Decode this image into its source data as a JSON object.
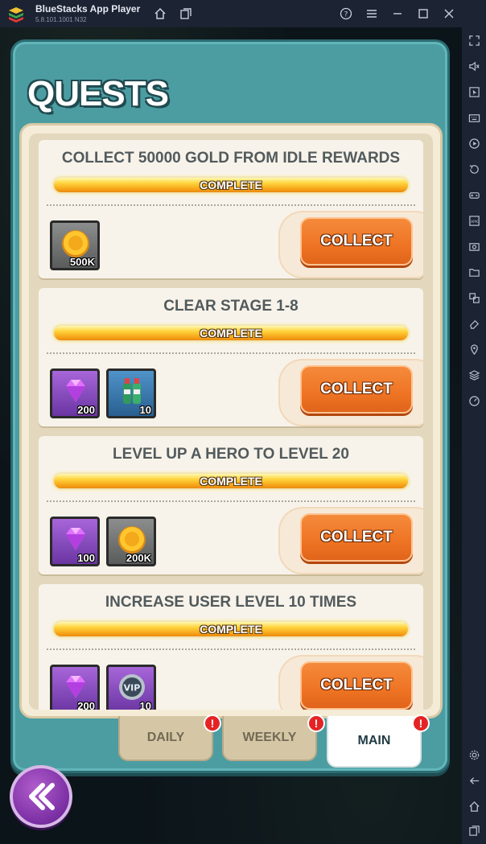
{
  "window": {
    "title": "BlueStacks App Player",
    "version": "5.8.101.1001 N32",
    "titlebar_icons": [
      "home-icon",
      "multi-instance-icon",
      "help-icon",
      "menu-icon",
      "minimize-icon",
      "maximize-icon",
      "close-icon"
    ],
    "sidebar_icons": [
      "fullscreen-icon",
      "volume-icon",
      "cursor-icon",
      "keyboard-icon",
      "record-icon",
      "rotate-icon",
      "gamepad-icon",
      "apk-icon",
      "screenshot-icon",
      "folder-icon",
      "resize-icon",
      "erase-icon",
      "location-icon",
      "layers-icon",
      "speed-icon",
      "settings-icon",
      "back-icon",
      "android-home-icon",
      "recents-icon"
    ]
  },
  "quests": {
    "title": "QUESTS",
    "items": [
      {
        "name": "COLLECT 50000 GOLD FROM IDLE REWARDS",
        "status": "COMPLETE",
        "progress": 1.0,
        "rewards": [
          {
            "icon": "gold-coin-icon",
            "quantity": "500K",
            "frame": "gray"
          }
        ],
        "action": "COLLECT"
      },
      {
        "name": "CLEAR STAGE 1-8",
        "status": "COMPLETE",
        "progress": 1.0,
        "rewards": [
          {
            "icon": "purple-gem-icon",
            "quantity": "200",
            "frame": "purple"
          },
          {
            "icon": "potion-bottles-icon",
            "quantity": "10",
            "frame": "blue"
          }
        ],
        "action": "COLLECT"
      },
      {
        "name": "LEVEL UP A HERO TO LEVEL 20",
        "status": "COMPLETE",
        "progress": 1.0,
        "rewards": [
          {
            "icon": "purple-gem-icon",
            "quantity": "100",
            "frame": "purple"
          },
          {
            "icon": "gold-coin-icon",
            "quantity": "200K",
            "frame": "gray"
          }
        ],
        "action": "COLLECT"
      },
      {
        "name": "INCREASE USER LEVEL 10 TIMES",
        "status": "COMPLETE",
        "progress": 1.0,
        "rewards": [
          {
            "icon": "purple-gem-icon",
            "quantity": "200",
            "frame": "purple"
          },
          {
            "icon": "vip-token-icon",
            "quantity": "10",
            "frame": "purple"
          }
        ],
        "action": "COLLECT"
      }
    ]
  },
  "tabs": [
    {
      "label": "DAILY",
      "alert": "!",
      "active": false
    },
    {
      "label": "WEEKLY",
      "alert": "!",
      "active": false
    },
    {
      "label": "MAIN",
      "alert": "!",
      "active": true
    }
  ],
  "colors": {
    "frame": "#4c9da2",
    "panel": "#f4ecd7",
    "collect_button": "#ee7424",
    "progress_fill": "#ffd640",
    "back_button": "#7a2fa3"
  }
}
